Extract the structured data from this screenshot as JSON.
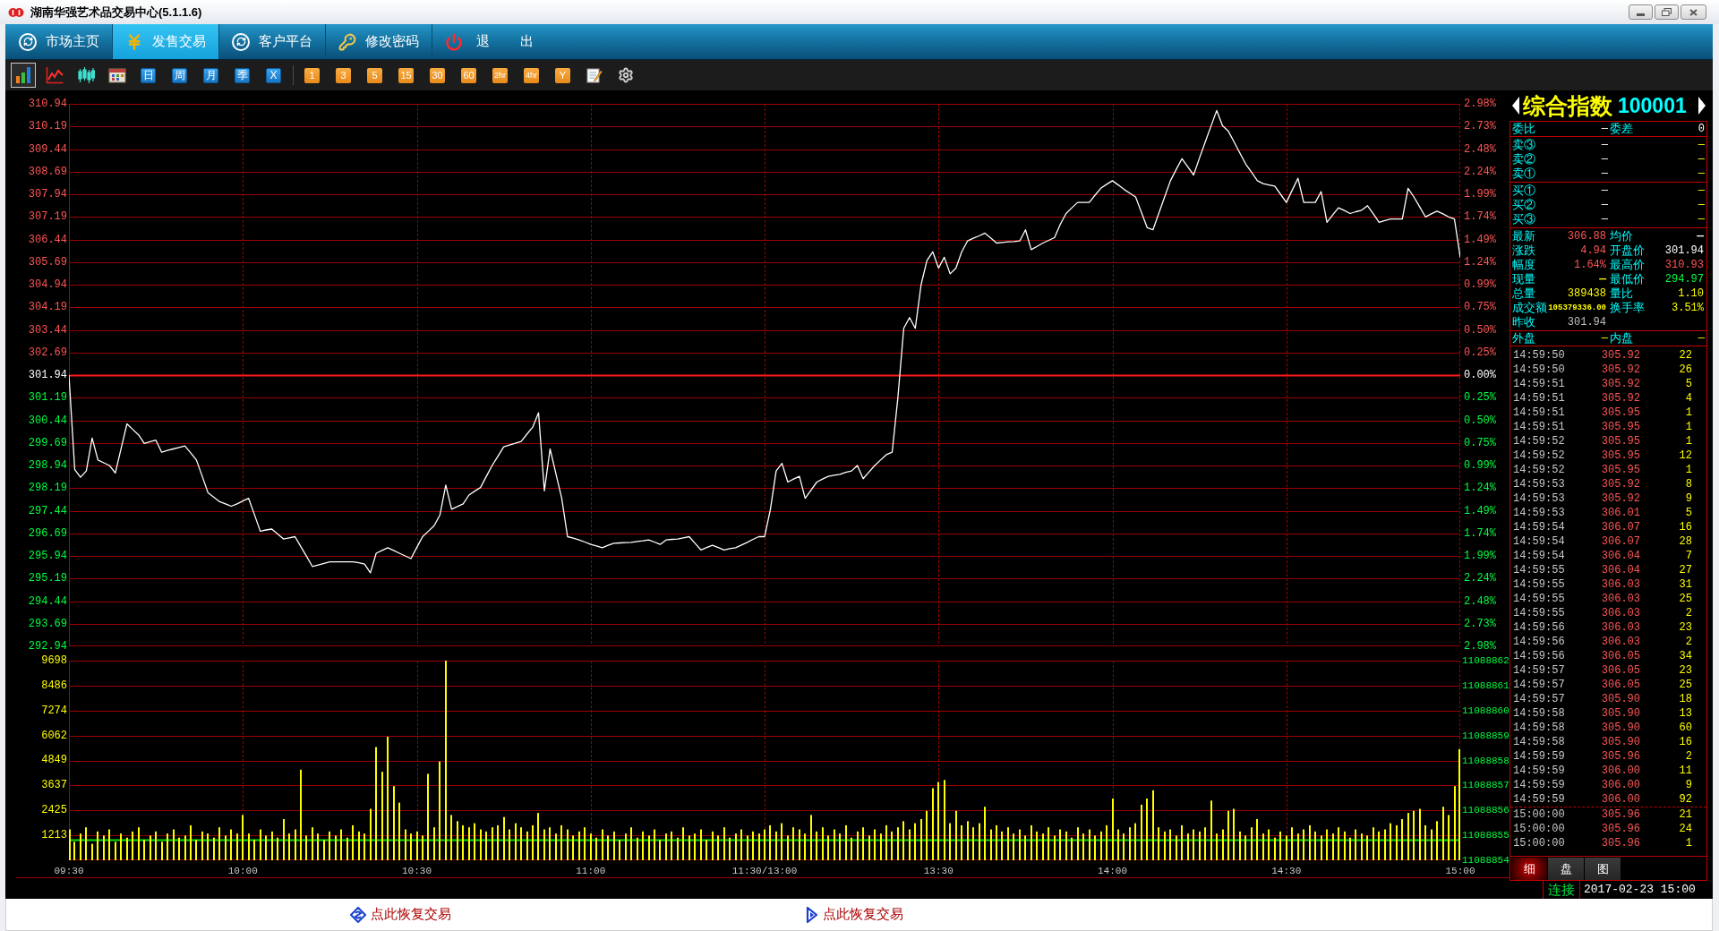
{
  "window": {
    "title": "湖南华强艺术品交易中心(5.1.1.6)"
  },
  "menu": [
    {
      "label": "市场主页",
      "selected": false
    },
    {
      "label": "发售交易",
      "selected": true
    },
    {
      "label": "客户平台",
      "selected": false
    },
    {
      "label": "修改密码",
      "selected": false
    },
    {
      "label": "退 出",
      "selected": false
    }
  ],
  "toolbar": {
    "chart_modes": [
      {
        "selected": true
      },
      {
        "selected": false
      },
      {
        "selected": false
      },
      {
        "selected": false
      }
    ],
    "cycle_buttons": [
      "日",
      "周",
      "月",
      "季",
      "X"
    ],
    "minute_buttons": [
      "1",
      "3",
      "5",
      "15",
      "30",
      "60",
      "2hr",
      "4hr",
      "Y"
    ]
  },
  "price_chart": {
    "right_labels": [
      "2.98%",
      "2.73%",
      "2.48%",
      "2.24%",
      "1.99%",
      "1.74%",
      "1.49%",
      "1.24%",
      "0.99%",
      "0.75%",
      "0.50%",
      "0.25%",
      "0.00%",
      "0.25%",
      "0.50%",
      "0.75%",
      "0.99%",
      "1.24%",
      "1.49%",
      "1.74%",
      "1.99%",
      "2.24%",
      "2.48%",
      "2.73%",
      "2.98%"
    ],
    "chart_data": {
      "type": "line",
      "grid": true,
      "ylim": [
        292.94,
        310.94
      ],
      "yticks": [
        {
          "value": 310.94,
          "label": "310.94"
        },
        {
          "value": 310.19,
          "label": "310.19"
        },
        {
          "value": 309.44,
          "label": "309.44"
        },
        {
          "value": 308.69,
          "label": "308.69"
        },
        {
          "value": 307.94,
          "label": "307.94"
        },
        {
          "value": 307.19,
          "label": "307.19"
        },
        {
          "value": 306.44,
          "label": "306.44"
        },
        {
          "value": 305.69,
          "label": "305.69"
        },
        {
          "value": 304.94,
          "label": "304.94"
        },
        {
          "value": 304.19,
          "label": "304.19"
        },
        {
          "value": 303.44,
          "label": "303.44"
        },
        {
          "value": 302.69,
          "label": "302.69"
        },
        {
          "value": 301.94,
          "label": "301.94"
        },
        {
          "value": 301.19,
          "label": "301.19"
        },
        {
          "value": 300.44,
          "label": "300.44"
        },
        {
          "value": 299.69,
          "label": "299.69"
        },
        {
          "value": 298.94,
          "label": "298.94"
        },
        {
          "value": 298.19,
          "label": "298.19"
        },
        {
          "value": 297.44,
          "label": "297.44"
        },
        {
          "value": 296.69,
          "label": "296.69"
        },
        {
          "value": 295.94,
          "label": "295.94"
        },
        {
          "value": 295.19,
          "label": "295.19"
        },
        {
          "value": 294.44,
          "label": "294.44"
        },
        {
          "value": 293.69,
          "label": "293.69"
        },
        {
          "value": 292.94,
          "label": "292.94"
        }
      ],
      "ref_lines": [
        {
          "axis": "y",
          "value": 301.94,
          "color": "#ff1a1a"
        }
      ],
      "categories": [
        null,
        null,
        null,
        null,
        null,
        null,
        null,
        null,
        null,
        null,
        null,
        null,
        null,
        null,
        null,
        null,
        null,
        null,
        null,
        null,
        null,
        null,
        null,
        null,
        null,
        null,
        null,
        null,
        null,
        null,
        null,
        null,
        null,
        null,
        null,
        null,
        null,
        null,
        null,
        null,
        null,
        null,
        null,
        null,
        null,
        null,
        null,
        null,
        null,
        null,
        null,
        null,
        null,
        null,
        null,
        null,
        null,
        null,
        null,
        null,
        null,
        null,
        null,
        null,
        null,
        null,
        null,
        null,
        null,
        null,
        null,
        null,
        null,
        null,
        null,
        null,
        null,
        null,
        null,
        null,
        null,
        null,
        null,
        null,
        null,
        null,
        null,
        null,
        null,
        null,
        null,
        null,
        null,
        null,
        null,
        null,
        null,
        null,
        null,
        null,
        null,
        null,
        null,
        null,
        null,
        null,
        null,
        null,
        null,
        null,
        null,
        null,
        null,
        null,
        null,
        null,
        null,
        null,
        null,
        null,
        null,
        null,
        null,
        null,
        null,
        null,
        null,
        null,
        null,
        null,
        null,
        null,
        null,
        null,
        null,
        null,
        null,
        null,
        null,
        null,
        null,
        null,
        null,
        null,
        null,
        null,
        null,
        null,
        null,
        null,
        null,
        null,
        null,
        null,
        null,
        null,
        null,
        null,
        null,
        null,
        null,
        null,
        null,
        null,
        null,
        null,
        null,
        null,
        null,
        null,
        null,
        null,
        null,
        null,
        null,
        null,
        null,
        null,
        null,
        null,
        null,
        null,
        null,
        null,
        null,
        null,
        null,
        null,
        null,
        null,
        null,
        null,
        null,
        null,
        null,
        null,
        null,
        null,
        null,
        null,
        null,
        null,
        null,
        null,
        null,
        null,
        null,
        null,
        null,
        null,
        null,
        null,
        null,
        null,
        null,
        null,
        null,
        null,
        null,
        null,
        null,
        null,
        null,
        null,
        null,
        null,
        null,
        null,
        null,
        null,
        null,
        null,
        null,
        null,
        null,
        null,
        null,
        null,
        null,
        null,
        null
      ],
      "series": [
        {
          "color": "#ffffff",
          "values": [
            301.94,
            298.8,
            298.55,
            298.76,
            299.85,
            299.12,
            299.03,
            298.94,
            298.69,
            299.51,
            300.32,
            300.14,
            299.96,
            299.67,
            299.73,
            299.78,
            299.38,
            299.44,
            299.49,
            299.54,
            299.59,
            299.36,
            299.12,
            298.58,
            298.03,
            297.89,
            297.74,
            297.67,
            297.59,
            297.67,
            297.76,
            297.85,
            297.31,
            296.76,
            296.8,
            296.83,
            296.67,
            296.5,
            296.54,
            296.58,
            296.25,
            295.92,
            295.59,
            295.64,
            295.69,
            295.74,
            295.74,
            295.74,
            295.74,
            295.74,
            295.71,
            295.67,
            295.38,
            296.03,
            296.12,
            296.21,
            296.12,
            296.03,
            295.94,
            295.85,
            296.22,
            296.58,
            296.76,
            296.94,
            297.3,
            298.29,
            297.49,
            297.58,
            297.67,
            297.96,
            298.09,
            298.21,
            298.58,
            298.94,
            299.25,
            299.56,
            299.62,
            299.68,
            299.74,
            299.98,
            300.21,
            300.69,
            298.1,
            299.49,
            298.67,
            297.85,
            296.58,
            296.53,
            296.47,
            296.4,
            296.32,
            296.27,
            296.21,
            296.29,
            296.36,
            296.37,
            296.38,
            296.39,
            296.42,
            296.44,
            296.47,
            296.4,
            296.32,
            296.47,
            296.49,
            296.5,
            296.54,
            296.58,
            296.36,
            296.14,
            296.22,
            296.29,
            296.22,
            296.14,
            296.18,
            296.21,
            296.3,
            296.39,
            296.49,
            296.58,
            296.58,
            297.49,
            298.76,
            299.01,
            298.39,
            298.49,
            298.58,
            297.85,
            298.12,
            298.39,
            298.49,
            298.58,
            298.62,
            298.65,
            298.71,
            298.76,
            298.94,
            298.5,
            298.72,
            298.94,
            299.12,
            299.3,
            299.38,
            301.2,
            303.49,
            303.85,
            303.49,
            304.94,
            305.74,
            306.03,
            305.49,
            305.85,
            305.3,
            305.49,
            306.03,
            306.39,
            306.48,
            306.56,
            306.65,
            306.49,
            306.32,
            306.34,
            306.36,
            306.37,
            306.39,
            306.76,
            306.1,
            306.21,
            306.32,
            306.41,
            306.5,
            306.94,
            307.3,
            307.49,
            307.67,
            307.67,
            307.67,
            307.91,
            308.14,
            308.27,
            308.39,
            308.25,
            308.1,
            307.98,
            307.85,
            307.34,
            306.83,
            306.76,
            307.31,
            307.85,
            308.39,
            308.76,
            309.12,
            308.85,
            308.58,
            309.13,
            309.67,
            310.2,
            310.72,
            310.21,
            310.03,
            309.67,
            309.3,
            308.94,
            308.67,
            308.39,
            308.29,
            308.25,
            308.21,
            307.94,
            307.67,
            308.07,
            308.47,
            307.67,
            307.67,
            307.67,
            308.03,
            307.01,
            307.25,
            307.49,
            307.4,
            307.3,
            307.36,
            307.41,
            307.56,
            307.29,
            307.01,
            307.07,
            307.12,
            307.12,
            307.12,
            308.14,
            307.85,
            307.52,
            307.19,
            307.29,
            307.38,
            307.29,
            307.19,
            307.12,
            305.85
          ]
        }
      ]
    }
  },
  "volume_chart": {
    "right_labels": [
      "11088862",
      "11088861",
      "11088860",
      "11088859",
      "11088858",
      "11088857",
      "11088856",
      "11088855",
      "11088854"
    ],
    "chart_data": {
      "type": "bar",
      "grid": true,
      "ylim": [
        0,
        9698
      ],
      "yticks": [
        {
          "value": 9698,
          "label": "9698"
        },
        {
          "value": 8486,
          "label": "8486"
        },
        {
          "value": 7274,
          "label": "7274"
        },
        {
          "value": 6062,
          "label": "6062"
        },
        {
          "value": 4849,
          "label": "4849"
        },
        {
          "value": 3637,
          "label": "3637"
        },
        {
          "value": 2425,
          "label": "2425"
        },
        {
          "value": 1213,
          "label": "1213"
        }
      ],
      "ref_lines": [
        {
          "axis": "y",
          "value": 1000,
          "color": "#00e000"
        }
      ],
      "categories": [
        "09:30",
        null,
        null,
        null,
        null,
        null,
        null,
        null,
        null,
        null,
        null,
        null,
        null,
        null,
        null,
        null,
        null,
        null,
        null,
        null,
        null,
        null,
        null,
        null,
        null,
        null,
        null,
        null,
        null,
        null,
        "10:00",
        null,
        null,
        null,
        null,
        null,
        null,
        null,
        null,
        null,
        null,
        null,
        null,
        null,
        null,
        null,
        null,
        null,
        null,
        null,
        null,
        null,
        null,
        null,
        null,
        null,
        null,
        null,
        null,
        null,
        "10:30",
        null,
        null,
        null,
        null,
        null,
        null,
        null,
        null,
        null,
        null,
        null,
        null,
        null,
        null,
        null,
        null,
        null,
        null,
        null,
        null,
        null,
        null,
        null,
        null,
        null,
        null,
        null,
        null,
        null,
        "11:00",
        null,
        null,
        null,
        null,
        null,
        null,
        null,
        null,
        null,
        null,
        null,
        null,
        null,
        null,
        null,
        null,
        null,
        null,
        null,
        null,
        null,
        null,
        null,
        null,
        null,
        null,
        null,
        null,
        null,
        "11:30/13:00",
        null,
        null,
        null,
        null,
        null,
        null,
        null,
        null,
        null,
        null,
        null,
        null,
        null,
        null,
        null,
        null,
        null,
        null,
        null,
        null,
        null,
        null,
        null,
        null,
        null,
        null,
        null,
        null,
        null,
        "13:30",
        null,
        null,
        null,
        null,
        null,
        null,
        null,
        null,
        null,
        null,
        null,
        null,
        null,
        null,
        null,
        null,
        null,
        null,
        null,
        null,
        null,
        null,
        null,
        null,
        null,
        null,
        null,
        null,
        null,
        "14:00",
        null,
        null,
        null,
        null,
        null,
        null,
        null,
        null,
        null,
        null,
        null,
        null,
        null,
        null,
        null,
        null,
        null,
        null,
        null,
        null,
        null,
        null,
        null,
        null,
        null,
        null,
        null,
        null,
        null,
        "14:30",
        null,
        null,
        null,
        null,
        null,
        null,
        null,
        null,
        null,
        null,
        null,
        null,
        null,
        null,
        null,
        null,
        null,
        null,
        null,
        null,
        null,
        null,
        null,
        null,
        null,
        null,
        null,
        null,
        null,
        "15:00"
      ],
      "series": [
        {
          "color": "#ffff00",
          "values": [
            1500,
            900,
            1300,
            1600,
            800,
            1400,
            1200,
            1500,
            900,
            1300,
            1100,
            1400,
            1600,
            1000,
            1200,
            1400,
            900,
            1300,
            1500,
            1100,
            1200,
            1700,
            1000,
            1400,
            1300,
            1100,
            1600,
            1200,
            1500,
            1300,
            2200,
            1300,
            1000,
            1500,
            1200,
            1400,
            1100,
            2000,
            1300,
            1500,
            4400,
            1200,
            1600,
            1300,
            1000,
            1400,
            1200,
            1500,
            1100,
            1700,
            1400,
            1300,
            2500,
            5500,
            4300,
            6000,
            3600,
            2800,
            1500,
            1300,
            1400,
            1200,
            4200,
            1600,
            4800,
            9698,
            2200,
            1900,
            1700,
            1600,
            1800,
            1500,
            1400,
            1600,
            1700,
            2100,
            1500,
            1800,
            1600,
            1400,
            1700,
            2300,
            1500,
            1600,
            1300,
            1700,
            1500,
            1200,
            1400,
            1600,
            1300,
            1100,
            1500,
            1200,
            1400,
            1000,
            1300,
            1600,
            1100,
            1400,
            1200,
            1500,
            1000,
            1300,
            1400,
            1100,
            1600,
            1200,
            1300,
            1500,
            1000,
            1400,
            1200,
            1600,
            1100,
            1300,
            1500,
            1200,
            1400,
            1300,
            1500,
            1700,
            1400,
            1800,
            1200,
            1600,
            1500,
            1300,
            2200,
            1400,
            1600,
            1200,
            1500,
            1300,
            1700,
            1100,
            1400,
            1600,
            1200,
            1500,
            1300,
            1700,
            1400,
            1600,
            1900,
            1500,
            1800,
            2000,
            2400,
            3500,
            3800,
            3900,
            1800,
            2400,
            1700,
            1900,
            1600,
            1800,
            2600,
            1500,
            1700,
            1400,
            1600,
            1300,
            1500,
            1200,
            1700,
            1400,
            1300,
            1600,
            1200,
            1500,
            1400,
            1100,
            1600,
            1300,
            1500,
            1200,
            1400,
            1700,
            3000,
            1500,
            1300,
            1600,
            1800,
            2700,
            3000,
            3400,
            1600,
            1400,
            1500,
            1200,
            1700,
            1300,
            1500,
            1400,
            1600,
            2900,
            1300,
            1500,
            2400,
            2500,
            1400,
            1200,
            1600,
            2000,
            1300,
            1500,
            1100,
            1400,
            1200,
            1600,
            1300,
            1500,
            1700,
            1400,
            1200,
            1500,
            1300,
            1600,
            1400,
            1100,
            1500,
            1300,
            1200,
            1600,
            1400,
            1500,
            1800,
            1700,
            2000,
            2300,
            2400,
            2500,
            1700,
            1500,
            1900,
            2600,
            2200,
            3600,
            5400
          ]
        }
      ]
    }
  },
  "quote_panel": {
    "name": "综合指数",
    "code": "100001",
    "ratio": [
      {
        "label": "委比",
        "value": "—"
      },
      {
        "label": "委差",
        "value": "0"
      }
    ],
    "asks": [
      {
        "label": "卖③",
        "price": "—",
        "volume": "—"
      },
      {
        "label": "卖②",
        "price": "—",
        "volume": "—"
      },
      {
        "label": "卖①",
        "price": "—",
        "volume": "—"
      }
    ],
    "bids": [
      {
        "label": "买①",
        "price": "—",
        "volume": "—"
      },
      {
        "label": "买②",
        "price": "—",
        "volume": "—"
      },
      {
        "label": "买③",
        "price": "—",
        "volume": "—"
      }
    ],
    "rows": [
      {
        "cells": [
          {
            "kind": "label",
            "text": "最新"
          },
          {
            "kind": "value",
            "text": "306.88",
            "color": "#ff5555"
          },
          {
            "kind": "label",
            "text": "均价"
          },
          {
            "kind": "value",
            "text": "—",
            "color": "#ffffff"
          }
        ]
      },
      {
        "cells": [
          {
            "kind": "label",
            "text": "涨跌"
          },
          {
            "kind": "value",
            "text": "4.94",
            "color": "#ff5555"
          },
          {
            "kind": "label",
            "text": "开盘价"
          },
          {
            "kind": "value",
            "text": "301.94",
            "color": "#ffffff"
          }
        ]
      },
      {
        "cells": [
          {
            "kind": "label",
            "text": "幅度"
          },
          {
            "kind": "value",
            "text": "1.64%",
            "color": "#ff5555"
          },
          {
            "kind": "label",
            "text": "最高价"
          },
          {
            "kind": "value",
            "text": "310.93",
            "color": "#ff5555"
          }
        ]
      },
      {
        "cells": [
          {
            "kind": "label",
            "text": "现量"
          },
          {
            "kind": "value",
            "text": "—",
            "color": "#ffff00"
          },
          {
            "kind": "label",
            "text": "最低价"
          },
          {
            "kind": "value",
            "text": "294.97",
            "color": "#00ff40"
          }
        ]
      },
      {
        "cells": [
          {
            "kind": "label",
            "text": "总量"
          },
          {
            "kind": "value",
            "text": "389438",
            "color": "#ffff00"
          },
          {
            "kind": "label",
            "text": "量比"
          },
          {
            "kind": "value",
            "text": "1.10",
            "color": "#ffff00"
          }
        ]
      },
      {
        "cells": [
          {
            "kind": "label",
            "text": "成交额"
          },
          {
            "kind": "value",
            "text": "105379336.00",
            "color": "#ffff00"
          },
          {
            "kind": "label",
            "text": "换手率"
          },
          {
            "kind": "value",
            "text": "3.51%",
            "color": "#ffff00"
          }
        ]
      },
      {
        "cells": [
          {
            "kind": "label",
            "text": "昨收"
          },
          {
            "kind": "value",
            "text": "301.94",
            "color": "#c0c0c0"
          }
        ]
      }
    ],
    "outer_inner": [
      {
        "label": "外盘",
        "value": "—"
      },
      {
        "label": "内盘",
        "value": "—"
      }
    ],
    "trade_groups": [
      {
        "trades": [
          {
            "time": "14:59:50",
            "price": "305.92",
            "volume": "22"
          },
          {
            "time": "14:59:50",
            "price": "305.92",
            "volume": "26"
          },
          {
            "time": "14:59:51",
            "price": "305.92",
            "volume": "5"
          },
          {
            "time": "14:59:51",
            "price": "305.92",
            "volume": "4"
          },
          {
            "time": "14:59:51",
            "price": "305.95",
            "volume": "1"
          },
          {
            "time": "14:59:51",
            "price": "305.95",
            "volume": "1"
          },
          {
            "time": "14:59:52",
            "price": "305.95",
            "volume": "1"
          },
          {
            "time": "14:59:52",
            "price": "305.95",
            "volume": "12"
          },
          {
            "time": "14:59:52",
            "price": "305.95",
            "volume": "1"
          },
          {
            "time": "14:59:53",
            "price": "305.92",
            "volume": "8"
          },
          {
            "time": "14:59:53",
            "price": "305.92",
            "volume": "9"
          },
          {
            "time": "14:59:53",
            "price": "306.01",
            "volume": "5"
          },
          {
            "time": "14:59:54",
            "price": "306.07",
            "volume": "16"
          },
          {
            "time": "14:59:54",
            "price": "306.07",
            "volume": "28"
          },
          {
            "time": "14:59:54",
            "price": "306.04",
            "volume": "7"
          },
          {
            "time": "14:59:55",
            "price": "306.04",
            "volume": "27"
          },
          {
            "time": "14:59:55",
            "price": "306.03",
            "volume": "31"
          },
          {
            "time": "14:59:55",
            "price": "306.03",
            "volume": "25"
          },
          {
            "time": "14:59:55",
            "price": "306.03",
            "volume": "2"
          },
          {
            "time": "14:59:56",
            "price": "306.03",
            "volume": "23"
          },
          {
            "time": "14:59:56",
            "price": "306.03",
            "volume": "2"
          },
          {
            "time": "14:59:56",
            "price": "306.05",
            "volume": "34"
          },
          {
            "time": "14:59:57",
            "price": "306.05",
            "volume": "23"
          },
          {
            "time": "14:59:57",
            "price": "306.05",
            "volume": "25"
          },
          {
            "time": "14:59:57",
            "price": "305.90",
            "volume": "18"
          },
          {
            "time": "14:59:58",
            "price": "305.90",
            "volume": "13"
          },
          {
            "time": "14:59:58",
            "price": "305.90",
            "volume": "60"
          },
          {
            "time": "14:59:58",
            "price": "305.90",
            "volume": "16"
          },
          {
            "time": "14:59:59",
            "price": "305.96",
            "volume": "2"
          },
          {
            "time": "14:59:59",
            "price": "306.00",
            "volume": "11"
          },
          {
            "time": "14:59:59",
            "price": "306.00",
            "volume": "9"
          },
          {
            "time": "14:59:59",
            "price": "306.00",
            "volume": "92"
          }
        ]
      },
      {
        "trades": [
          {
            "time": "15:00:00",
            "price": "305.96",
            "volume": "21"
          },
          {
            "time": "15:00:00",
            "price": "305.96",
            "volume": "24"
          },
          {
            "time": "15:00:00",
            "price": "305.96",
            "volume": "1"
          }
        ]
      }
    ],
    "tabs": [
      {
        "label": "细",
        "selected": true
      },
      {
        "label": "盘",
        "selected": false
      },
      {
        "label": "图",
        "selected": false
      }
    ]
  },
  "status_bar": {
    "connection": "连接",
    "datetime": "2017-02-23 15:00"
  },
  "footer_links": [
    "点此恢复交易",
    "点此恢复交易"
  ]
}
